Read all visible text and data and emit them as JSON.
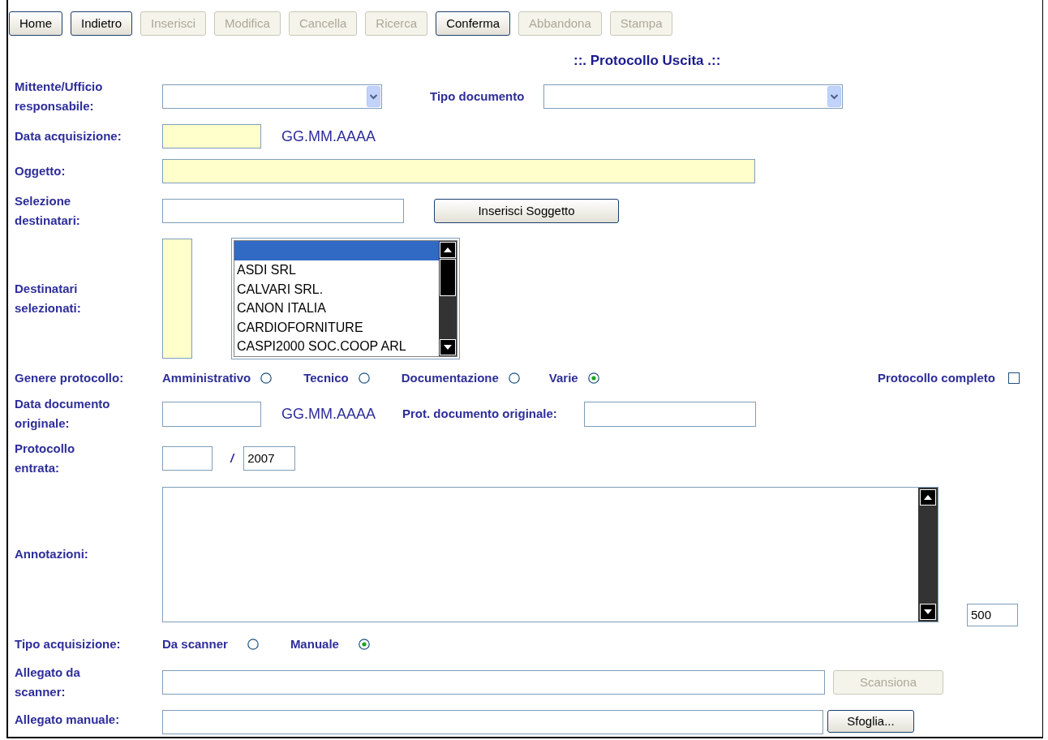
{
  "toolbar": [
    {
      "label": "Home",
      "disabled": false
    },
    {
      "label": "Indietro",
      "disabled": false
    },
    {
      "label": "Inserisci",
      "disabled": true
    },
    {
      "label": "Modifica",
      "disabled": true
    },
    {
      "label": "Cancella",
      "disabled": true
    },
    {
      "label": "Ricerca",
      "disabled": true
    },
    {
      "label": "Conferma",
      "disabled": false
    },
    {
      "label": "Abbandona",
      "disabled": true
    },
    {
      "label": "Stampa",
      "disabled": true
    }
  ],
  "title": "::. Protocollo Uscita .::",
  "mittente": {
    "label": "Mittente/Ufficio\nresponsabile:"
  },
  "tipo_documento": {
    "label": "Tipo documento"
  },
  "data_acquisizione": {
    "label": "Data acquisizione:",
    "format": "GG.MM.AAAA"
  },
  "oggetto": {
    "label": "Oggetto:"
  },
  "selezione_destinatari": {
    "label": "Selezione\ndestinatari:",
    "button": "Inserisci Soggetto"
  },
  "destinatari_selezionati": {
    "label": "Destinatari\nselezionati:",
    "blank_option_selected": true,
    "options": [
      {
        "label": "ASDI SRL",
        "selected": false
      },
      {
        "label": "CALVARI SRL.",
        "selected": false
      },
      {
        "label": "CANON ITALIA",
        "selected": false
      },
      {
        "label": "CARDIOFORNITURE",
        "selected": false
      },
      {
        "label": "CASPI2000 SOC.COOP ARL",
        "selected": false
      }
    ]
  },
  "genere_protocollo": {
    "label": "Genere protocollo:",
    "options": [
      {
        "label": "Amministrativo",
        "selected": false
      },
      {
        "label": "Tecnico",
        "selected": false
      },
      {
        "label": "Documentazione",
        "selected": false
      },
      {
        "label": "Varie",
        "selected": true
      }
    ],
    "completo": {
      "label": "Protocollo completo",
      "checked": false
    }
  },
  "data_documento": {
    "label": "Data documento\noriginale:",
    "format": "GG.MM.AAAA",
    "prot_label": "Prot. documento originale:"
  },
  "protocollo_entrata": {
    "label": "Protocollo\nentrata:",
    "separator": "/",
    "year": "2007"
  },
  "annotazioni": {
    "label": "Annotazioni:",
    "counter": "500"
  },
  "tipo_acquisizione": {
    "label": "Tipo acquisizione:",
    "options": [
      {
        "label": "Da scanner",
        "selected": false
      },
      {
        "label": "Manuale",
        "selected": true
      }
    ]
  },
  "allegato_scanner": {
    "label": "Allegato da\nscanner:",
    "button": "Scansiona",
    "disabled": true
  },
  "allegato_manuale": {
    "label": "Allegato manuale:",
    "button": "Sfoglia...",
    "disabled": false
  }
}
